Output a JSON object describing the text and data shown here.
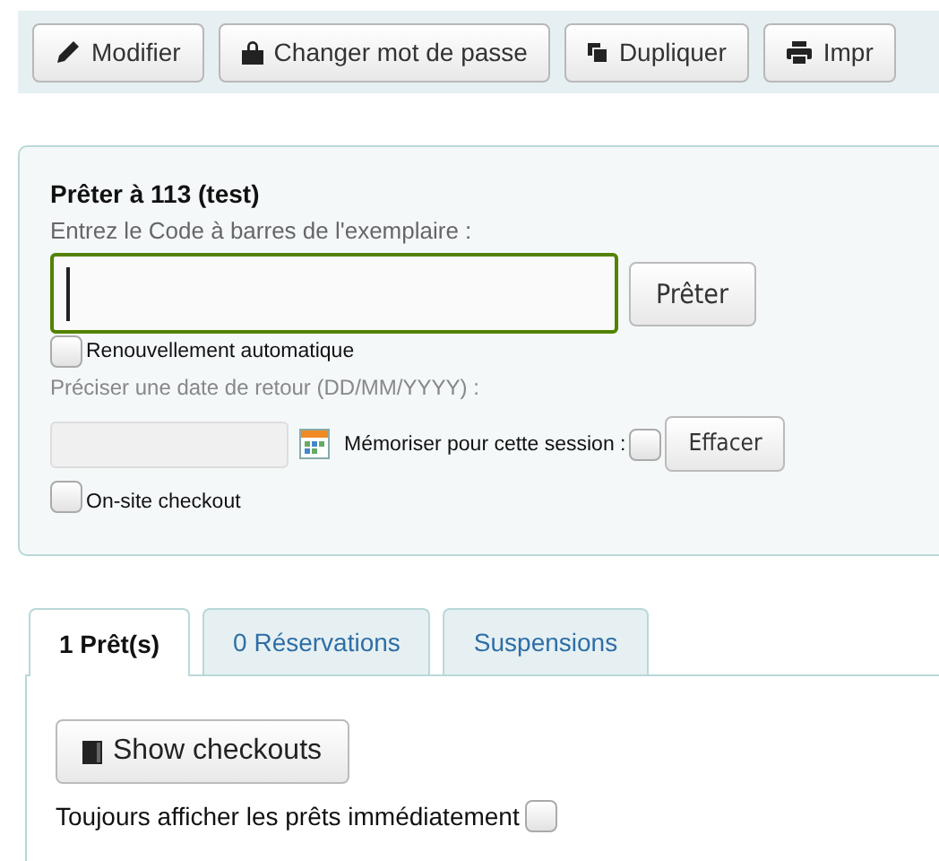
{
  "toolbar": {
    "buttons": [
      {
        "label": "Modifier",
        "kind": "edit"
      },
      {
        "label": "Changer mot de passe",
        "kind": "password"
      },
      {
        "label": "Dupliquer",
        "kind": "duplicate"
      },
      {
        "label": "Impr",
        "kind": "print"
      }
    ]
  },
  "checkout": {
    "title": "Prêter à 113 (test)",
    "barcode_label": "Entrez le Code à barres de l'exemplaire :",
    "barcode_field": {
      "focused": true
    },
    "submit": "Prêter",
    "auto_renew": {
      "label": "Renouvellement automatique",
      "checked": false
    },
    "due_date_label": "Préciser une date de retour (DD/MM/YYYY) :",
    "remember": {
      "label": "Mémoriser pour cette session :",
      "checked": false
    },
    "clear": "Effacer",
    "onsite": {
      "label": "On-site checkout",
      "checked": false
    }
  },
  "tabs": [
    {
      "label": "1 Prêt(s)",
      "selected": true
    },
    {
      "label": "0 Réservations",
      "selected": false
    },
    {
      "label": "Suspensions",
      "selected": false
    }
  ],
  "issues": {
    "show_button": "Show checkouts",
    "always_show": {
      "label": "Toujours afficher les prêts immédiatement",
      "checked": false
    }
  }
}
